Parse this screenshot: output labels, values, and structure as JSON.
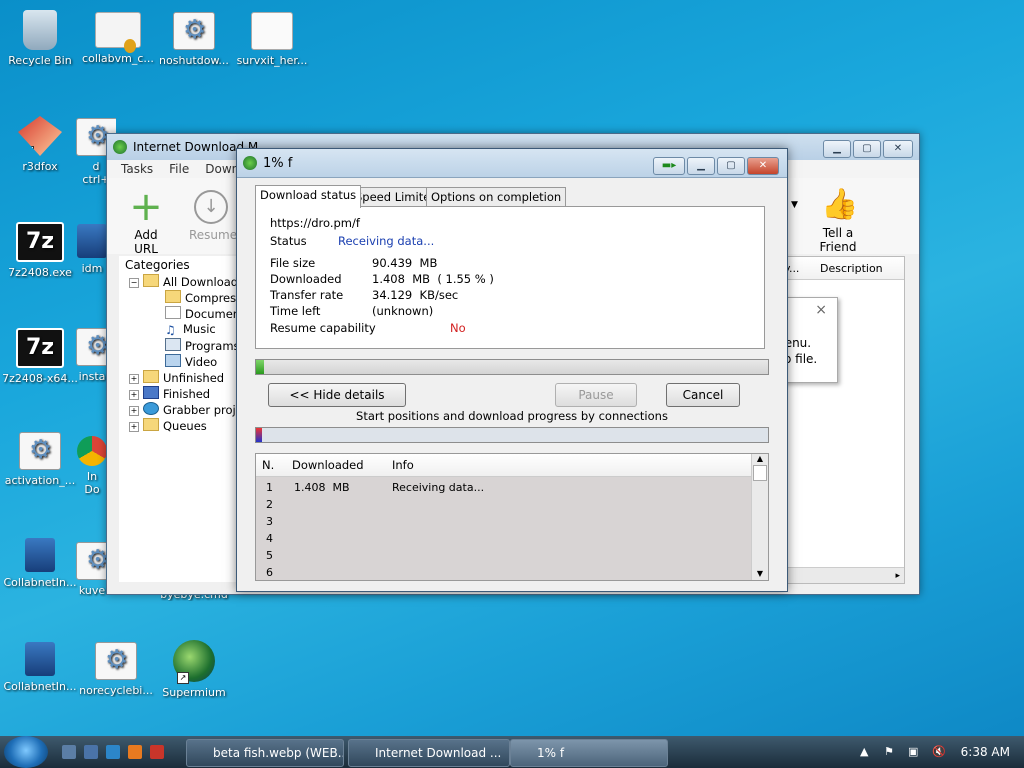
{
  "desktop": {
    "icons": [
      {
        "label": "Recycle Bin",
        "icon": "recycle-bin-icon"
      },
      {
        "label": "collabvm_c...",
        "icon": "certificate-icon"
      },
      {
        "label": "noshutdow...",
        "icon": "settings-file-icon"
      },
      {
        "label": "survxit_her...",
        "icon": "document-icon"
      },
      {
        "label": "r3dfox",
        "icon": "r3dfox-icon"
      },
      {
        "label": "d\nctrl+",
        "icon": "settings-file-icon"
      },
      {
        "label": "7z2408.exe",
        "icon": "7zip-icon"
      },
      {
        "label": "idm",
        "icon": "installer-icon"
      },
      {
        "label": "7z2408-x64...",
        "icon": "7zip-icon"
      },
      {
        "label": "insta",
        "icon": "settings-file-icon"
      },
      {
        "label": "activation_...",
        "icon": "settings-file-icon"
      },
      {
        "label": "In\nDo",
        "icon": "chrome-icon"
      },
      {
        "label": "CollabnetIn...",
        "icon": "computer-icon"
      },
      {
        "label": "kuve",
        "icon": "settings-file-icon"
      },
      {
        "label": "byebye.cmd",
        "icon": "cmd-icon"
      },
      {
        "label": "CollabnetIn...",
        "icon": "computer-icon"
      },
      {
        "label": "norecyclebi...",
        "icon": "settings-file-icon"
      },
      {
        "label": "Supermium",
        "icon": "supermium-icon"
      }
    ]
  },
  "idm": {
    "title": "Internet Download M",
    "menu": [
      "Tasks",
      "File",
      "Downlo"
    ],
    "toolbar": {
      "add_url": "Add URL",
      "resume": "Resume",
      "tell_friend": "Tell a Friend"
    },
    "categories_label": "Categories",
    "tree": {
      "all_downloads": "All Downloads",
      "children": [
        "Compresse",
        "Documents",
        "Music",
        "Programs",
        "Video"
      ],
      "unfinished": "Unfinished",
      "finished": "Finished",
      "grabber": "Grabber projec",
      "queues": "Queues"
    },
    "columns": {
      "partial": "y...",
      "description": "Description"
    },
    "popup": {
      "line1": "menu.",
      "line2": "elp file.",
      "close": "×"
    }
  },
  "dialog": {
    "title": "1% f",
    "tabs": [
      "Download status",
      "Speed Limiter",
      "Options on completion"
    ],
    "url": "https://dro.pm/f",
    "status_label": "Status",
    "status_value": "Receiving data...",
    "file_size_label": "File size",
    "file_size_value": "90.439  MB",
    "downloaded_label": "Downloaded",
    "downloaded_value": "1.408  MB  ( 1.55 % )",
    "transfer_rate_label": "Transfer rate",
    "transfer_rate_value": "34.129  KB/sec",
    "time_left_label": "Time left",
    "time_left_value": "(unknown)",
    "resume_label": "Resume capability",
    "resume_value": "No",
    "progress": 0.0155,
    "hide_details": "<< Hide details",
    "pause": "Pause",
    "cancel": "Cancel",
    "connections_caption": "Start positions and download progress by connections",
    "list_headers": [
      "N.",
      "Downloaded",
      "Info"
    ],
    "rows": [
      {
        "n": "1",
        "downloaded": "1.408  MB",
        "info": "Receiving data..."
      },
      {
        "n": "2",
        "downloaded": "",
        "info": ""
      },
      {
        "n": "3",
        "downloaded": "",
        "info": ""
      },
      {
        "n": "4",
        "downloaded": "",
        "info": ""
      },
      {
        "n": "5",
        "downloaded": "",
        "info": ""
      },
      {
        "n": "6",
        "downloaded": "",
        "info": ""
      }
    ],
    "colors": {
      "status": "#1a3fb0",
      "resume_no": "#d21f1f",
      "progress": "#2a9a1e"
    }
  },
  "taskbar": {
    "tasks": [
      "beta fish.webp (WEB...",
      "Internet Download ...",
      "1% f"
    ],
    "clock": "6:38 AM"
  }
}
